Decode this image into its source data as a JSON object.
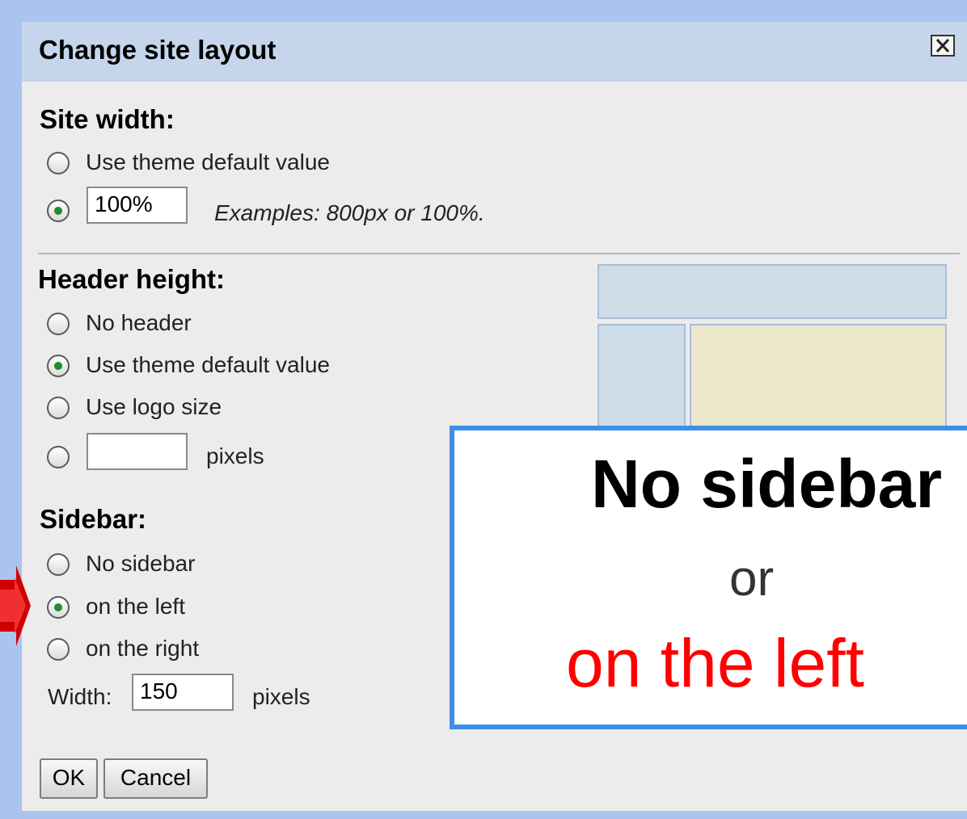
{
  "dialog": {
    "title": "Change site layout",
    "close_icon": "close-icon"
  },
  "site_width": {
    "heading": "Site width:",
    "option_default": "Use theme default value",
    "custom_value": "100%",
    "hint": "Examples: 800px or 100%."
  },
  "header_height": {
    "heading": "Header height:",
    "option_none": "No header",
    "option_default": "Use theme default value",
    "option_logo": "Use logo size",
    "custom_value": "",
    "unit": "pixels"
  },
  "sidebar": {
    "heading": "Sidebar:",
    "option_none": "No sidebar",
    "option_left": "on the left",
    "option_right": "on the right",
    "width_label": "Width:",
    "width_value": "150",
    "unit": "pixels"
  },
  "buttons": {
    "ok": "OK",
    "cancel": "Cancel"
  },
  "callout": {
    "line1": "No sidebar",
    "line2": "or",
    "line3": "on the left"
  },
  "colors": {
    "accent_blue": "#3d8fe6",
    "highlight_red": "#ff0000",
    "selected_radio": "#1f8d2d"
  }
}
